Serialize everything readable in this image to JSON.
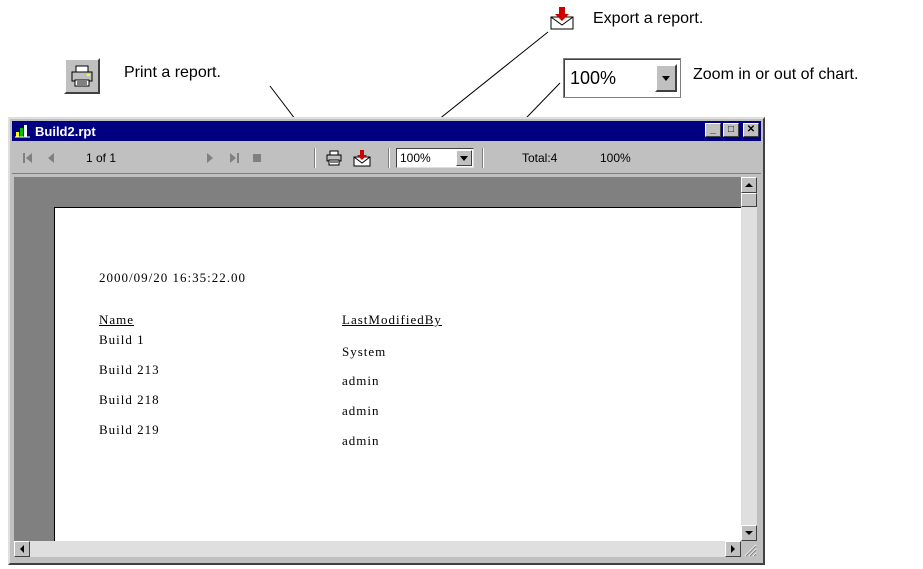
{
  "callouts": {
    "print_label": "Print a report.",
    "export_label": "Export a report.",
    "zoom_label": "Zoom in or out of chart.",
    "zoom_value": "100%"
  },
  "window": {
    "title": "Build2.rpt",
    "minimize_glyph": "_",
    "maximize_glyph": "□",
    "close_glyph": "✕"
  },
  "toolbar": {
    "page_indicator": "1 of 1",
    "zoom_value": "100%",
    "total_label": "Total:4",
    "percent_label": "100%",
    "icons": [
      "first-page-icon",
      "prev-page-icon",
      "next-page-icon",
      "last-page-icon",
      "stop-icon",
      "printer-icon",
      "export-icon",
      "chevron-down-icon"
    ]
  },
  "report": {
    "timestamp": "2000/09/20 16:35:22.00",
    "columns": [
      "Name",
      "LastModifiedBy"
    ],
    "rows": [
      {
        "name": "Build 1",
        "modified_by": "System"
      },
      {
        "name": "Build 213",
        "modified_by": "admin"
      },
      {
        "name": "Build 218",
        "modified_by": "admin"
      },
      {
        "name": "Build 219",
        "modified_by": "admin"
      }
    ]
  },
  "colors": {
    "titlebar": "#000080",
    "chrome": "#c0c0c0",
    "viewport_bg": "#808080",
    "export_icon_red": "#cc0000"
  }
}
